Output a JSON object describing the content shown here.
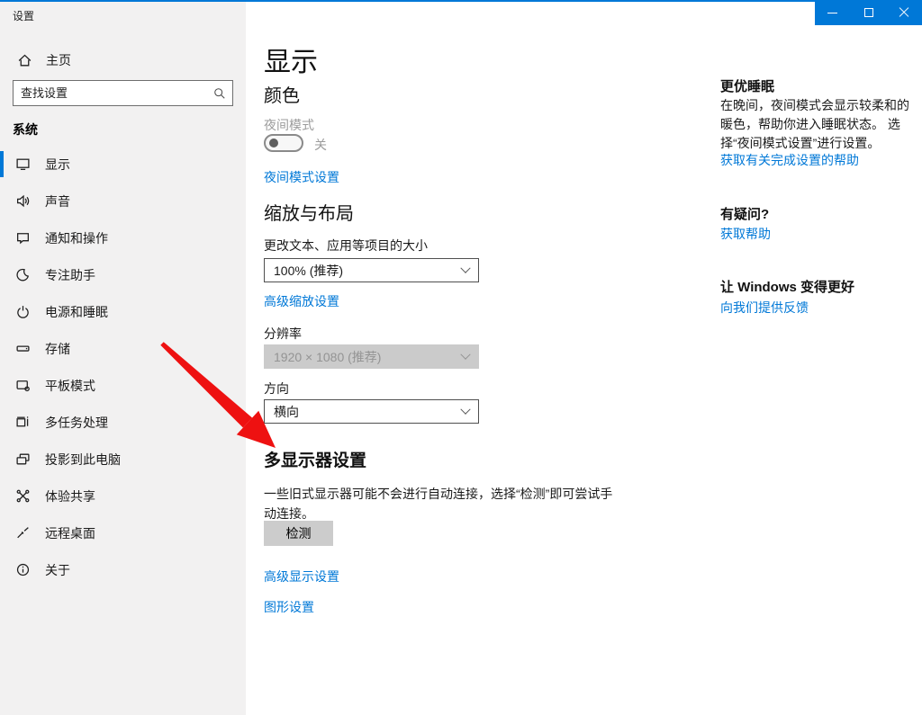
{
  "window": {
    "app_title": "设置",
    "controls": [
      "minimize",
      "maximize",
      "close"
    ],
    "accent_color": "#0078d7"
  },
  "sidebar": {
    "home_label": "主页",
    "search_placeholder": "查找设置",
    "section_header": "系统",
    "items": [
      {
        "label": "显示",
        "icon": "display-icon",
        "selected": true
      },
      {
        "label": "声音",
        "icon": "sound-icon",
        "selected": false
      },
      {
        "label": "通知和操作",
        "icon": "notifications-icon",
        "selected": false
      },
      {
        "label": "专注助手",
        "icon": "focus-assist-icon",
        "selected": false
      },
      {
        "label": "电源和睡眠",
        "icon": "power-icon",
        "selected": false
      },
      {
        "label": "存储",
        "icon": "storage-icon",
        "selected": false
      },
      {
        "label": "平板模式",
        "icon": "tablet-mode-icon",
        "selected": false
      },
      {
        "label": "多任务处理",
        "icon": "multitasking-icon",
        "selected": false
      },
      {
        "label": "投影到此电脑",
        "icon": "projecting-icon",
        "selected": false
      },
      {
        "label": "体验共享",
        "icon": "shared-experiences-icon",
        "selected": false
      },
      {
        "label": "远程桌面",
        "icon": "remote-desktop-icon",
        "selected": false
      },
      {
        "label": "关于",
        "icon": "about-icon",
        "selected": false
      }
    ]
  },
  "main": {
    "page_title": "显示",
    "color_section": {
      "heading": "颜色",
      "night_light_label": "夜间模式",
      "night_light_state": "关",
      "night_light_link": "夜间模式设置"
    },
    "scale_section": {
      "heading": "缩放与布局",
      "scale_label": "更改文本、应用等项目的大小",
      "scale_value": "100% (推荐)",
      "advanced_scaling_link": "高级缩放设置",
      "resolution_label": "分辨率",
      "resolution_value": "1920 × 1080 (推荐)",
      "orientation_label": "方向",
      "orientation_value": "横向"
    },
    "multi_display_section": {
      "heading": "多显示器设置",
      "description": "一些旧式显示器可能不会进行自动连接，选择“检测”即可尝试手动连接。",
      "detect_button": "检测",
      "advanced_display_link": "高级显示设置",
      "graphics_link": "图形设置"
    }
  },
  "aside": {
    "sleep_heading": "更优睡眠",
    "sleep_body": "在晚间，夜间模式会显示较柔和的暖色，帮助你进入睡眠状态。 选择“夜间模式设置”进行设置。",
    "sleep_link": "获取有关完成设置的帮助",
    "question_heading": "有疑问?",
    "question_link": "获取帮助",
    "feedback_heading": "让 Windows 变得更好",
    "feedback_link": "向我们提供反馈"
  },
  "annotation": {
    "arrow_color": "#ee1111",
    "points_to": "多显示器设置"
  }
}
